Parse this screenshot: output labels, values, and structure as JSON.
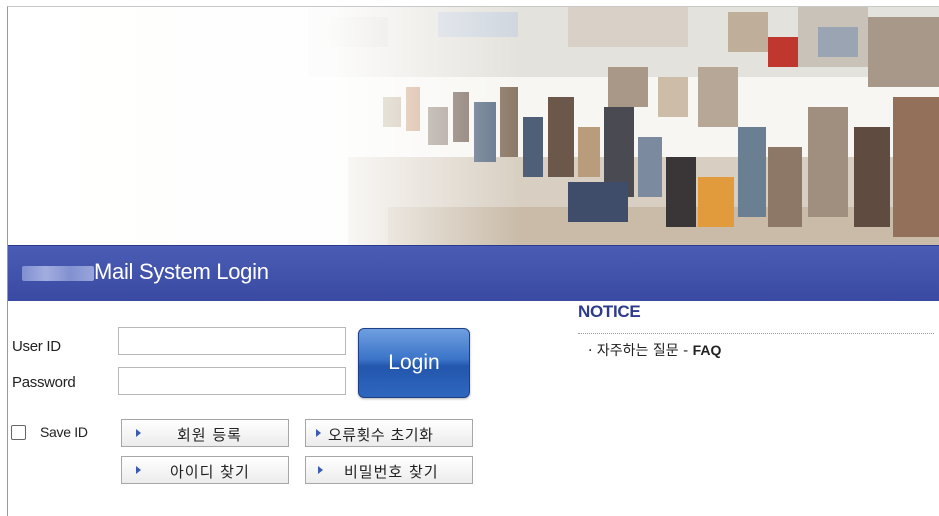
{
  "header": {
    "title_suffix": "Mail System Login"
  },
  "login_form": {
    "user_id_label": "User ID",
    "password_label": "Password",
    "user_id_value": "",
    "password_value": "",
    "login_button": "Login",
    "save_id_label": "Save ID",
    "save_id_checked": false
  },
  "actions": {
    "register": "회원 등록",
    "reset_errors": "오류횟수 초기화",
    "find_id": "아이디 찾기",
    "find_password": "비밀번호 찾기"
  },
  "notice": {
    "title": "NOTICE",
    "items": [
      {
        "prefix": "· 자주하는 질문 - ",
        "link": "FAQ"
      }
    ]
  },
  "colors": {
    "titlebar": "#3f50a9",
    "notice_title": "#2e3b8f",
    "login_button": "#2f67bf"
  }
}
